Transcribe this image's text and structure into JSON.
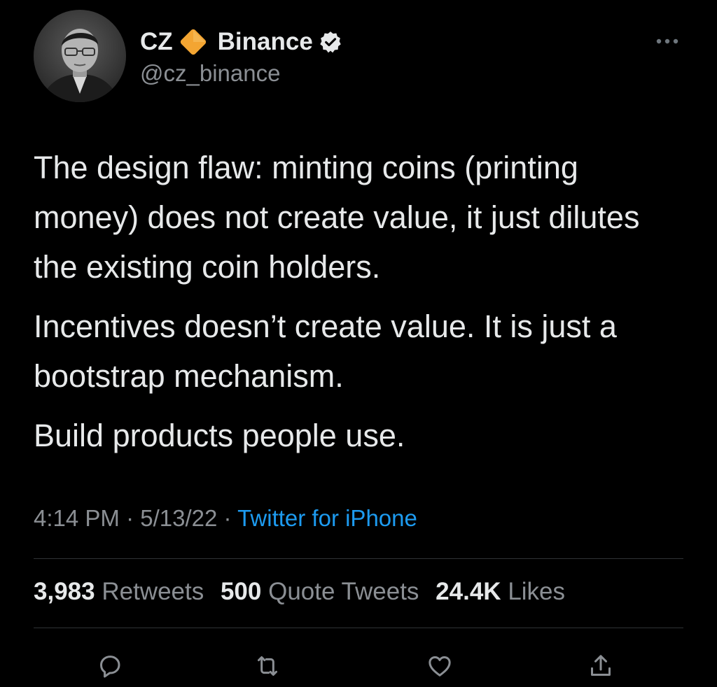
{
  "author": {
    "display_name": "CZ",
    "organization": "Binance",
    "handle": "@cz_binance",
    "badge_icon": "orange-diamond-icon",
    "verified_icon": "verified-badge-icon",
    "avatar": "profile-photo"
  },
  "tweet": {
    "paragraphs": [
      "The design flaw: minting coins (printing money) does not create value, it just dilutes the existing coin holders.",
      "Incentives doesn’t create value. It is just a bootstrap mechanism.",
      "Build products people use."
    ],
    "time": "4:14 PM",
    "date": "5/13/22",
    "separator": " · ",
    "source": "Twitter for iPhone"
  },
  "stats": {
    "retweets_count": "3,983",
    "retweets_label": "Retweets",
    "quotes_count": "500",
    "quotes_label": "Quote Tweets",
    "likes_count": "24.4K",
    "likes_label": "Likes"
  },
  "actions": [
    "reply-icon",
    "retweet-icon",
    "like-icon",
    "share-icon"
  ],
  "colors": {
    "background": "#000000",
    "text": "#e7e9ea",
    "muted": "#8b8f94",
    "link": "#1d9bf0",
    "badge": "#f3a532",
    "divider": "#2f3336"
  }
}
